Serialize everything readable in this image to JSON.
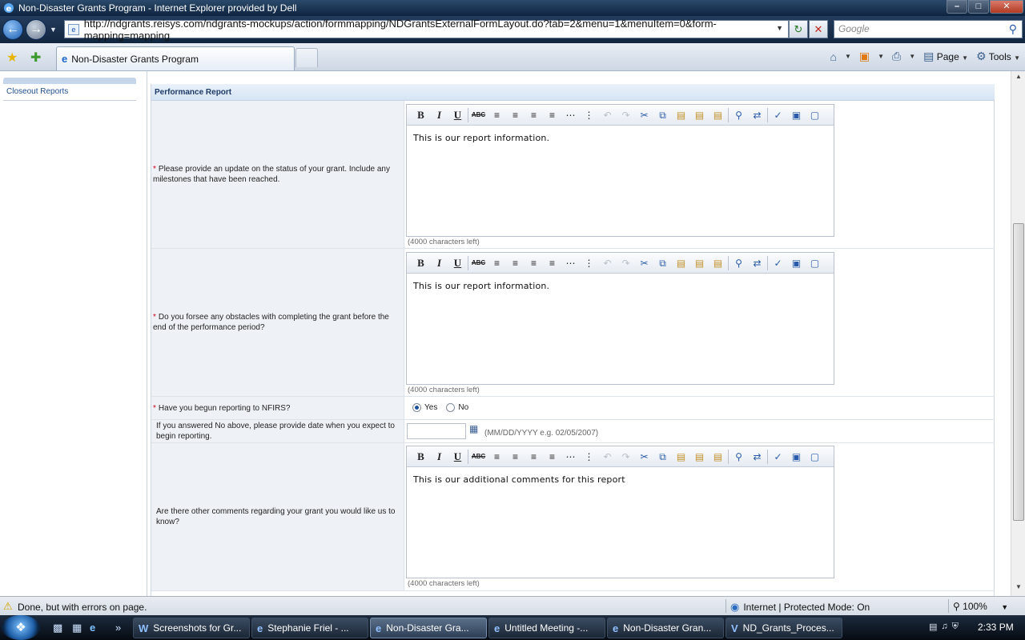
{
  "window": {
    "title": "Non-Disaster Grants Program - Internet Explorer provided by Dell",
    "minimize": "–",
    "maximize": "□",
    "close": "✕"
  },
  "address_bar": {
    "url": "http://ndgrants.reisys.com/ndgrants-mockups/action/formmapping/NDGrantsExternalFormLayout.do?tab=2&menu=1&menuItem=0&form-mapping=mapping",
    "search_placeholder": "Google"
  },
  "tabs": [
    {
      "label": "Non-Disaster Grants Program"
    }
  ],
  "command_bar": {
    "page_label": "Page",
    "tools_label": "Tools"
  },
  "sidebar": {
    "items": [
      {
        "label": "Closeout Reports"
      }
    ]
  },
  "form": {
    "section_title": "Performance Report",
    "questions": [
      {
        "required": "*",
        "label": "Please provide an update on the status of your grant. Include any milestones that have been reached.",
        "value": "This is our report information.",
        "chars_left": "(4000 characters left)"
      },
      {
        "required": "*",
        "label": "Do you forsee any obstacles with completing the grant before the end of the performance period?",
        "value": "This is our report information.",
        "chars_left": "(4000 characters left)"
      },
      {
        "required": "*",
        "label": "Have you begun reporting to NFIRS?",
        "options": [
          "Yes",
          "No"
        ],
        "selected": "Yes"
      },
      {
        "required": "",
        "label": "If you answered No above, please provide date when you expect to begin reporting.",
        "value": "",
        "hint": "(MM/DD/YYYY e.g. 02/05/2007)"
      },
      {
        "required": "",
        "label": "Are there other comments regarding your grant you would like us to know?",
        "value": "This is our additional comments for this report",
        "chars_left": "(4000 characters left)"
      }
    ]
  },
  "status_bar": {
    "message": "Done, but with errors on page.",
    "zone": "Internet | Protected Mode: On",
    "zoom": "100%"
  },
  "taskbar": {
    "buttons": [
      {
        "label": "Screenshots for Gr..."
      },
      {
        "label": "Stephanie Friel - ..."
      },
      {
        "label": "Non-Disaster Gra..."
      },
      {
        "label": "Untitled Meeting -..."
      },
      {
        "label": "Non-Disaster Gran..."
      },
      {
        "label": "ND_Grants_Proces..."
      }
    ],
    "clock": "2:33 PM"
  }
}
